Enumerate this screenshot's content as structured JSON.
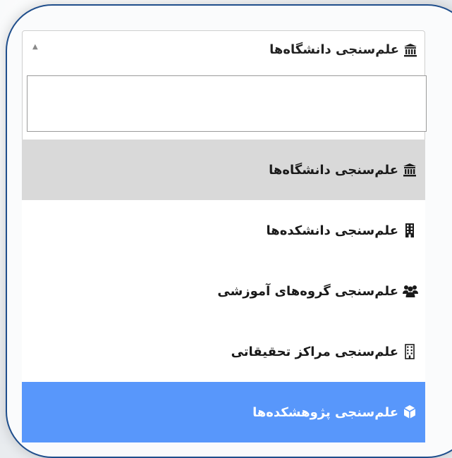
{
  "dropdown": {
    "selected_label": "علم‌سنجی دانشگاه‌ها",
    "selected_icon": "university-icon",
    "search": {
      "value": "",
      "placeholder": ""
    },
    "options": [
      {
        "label": "علم‌سنجی دانشگاه‌ها",
        "icon": "university-icon",
        "state": "hover"
      },
      {
        "label": "علم‌سنجی دانشکده‌ها",
        "icon": "building-icon",
        "state": "normal"
      },
      {
        "label": "علم‌سنجی گروه‌های آموزشی",
        "icon": "users-icon",
        "state": "normal"
      },
      {
        "label": "علم‌سنجی مراکز تحقیقاتی",
        "icon": "building-outline-icon",
        "state": "normal"
      },
      {
        "label": "علم‌سنجی پژوهشکده‌ها",
        "icon": "cube-icon",
        "state": "selected"
      }
    ]
  },
  "colors": {
    "highlight": "#5897fb",
    "hover": "#d9d9d9",
    "frame_border": "#1f4e8c"
  }
}
